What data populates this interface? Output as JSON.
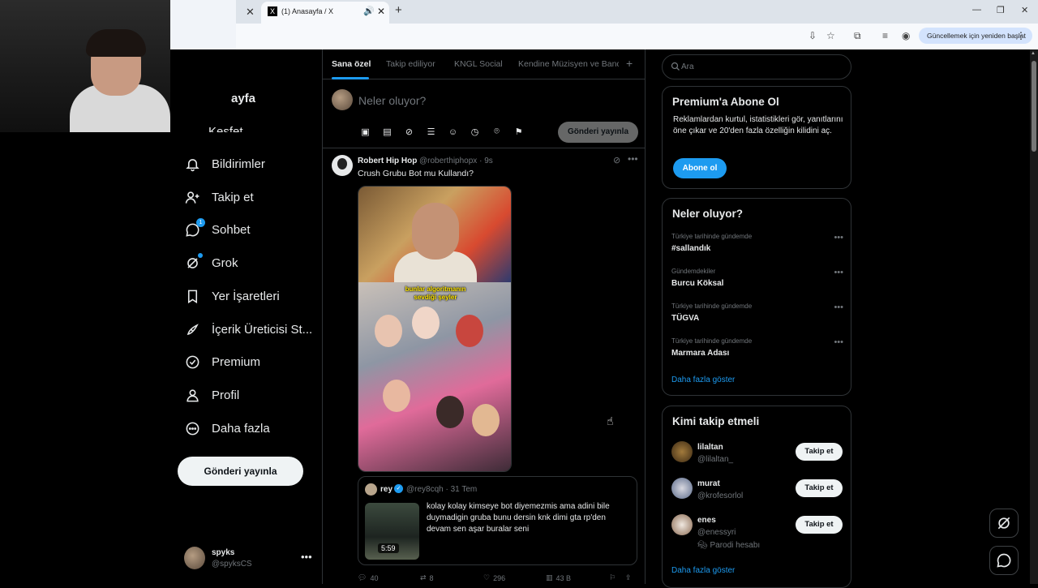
{
  "browser": {
    "tab_title": "(1) Anasayfa / X",
    "favicon": "X",
    "update_label": "Güncellemek için yeniden başlat"
  },
  "nav": {
    "partial_home": "ayfa",
    "partial_explore": "Keşfet",
    "items": [
      {
        "label": "Bildirimler",
        "icon": "bell-icon"
      },
      {
        "label": "Takip et",
        "icon": "add-user-icon"
      },
      {
        "label": "Sohbet",
        "icon": "chat-icon",
        "badge": "1"
      },
      {
        "label": "Grok",
        "icon": "grok-icon"
      },
      {
        "label": "Yer İşaretleri",
        "icon": "bookmark-icon"
      },
      {
        "label": "İçerik Üreticisi St...",
        "icon": "rocket-icon"
      },
      {
        "label": "Premium",
        "icon": "verified-icon"
      },
      {
        "label": "Profil",
        "icon": "person-icon"
      },
      {
        "label": "Daha fazla",
        "icon": "more-circle-icon"
      }
    ],
    "post_button": "Gönderi yayınla"
  },
  "account": {
    "name": "spyks",
    "handle": "@spyksCS"
  },
  "timeline": {
    "tabs": [
      "Sana özel",
      "Takip ediliyor",
      "KNGL Social",
      "Kendine Müzisyen ve Banc"
    ],
    "composer_placeholder": "Neler oluyor?",
    "composer_post": "Gönderi yayınla"
  },
  "tweet": {
    "name": "Robert Hip Hop",
    "handle": "@roberthiphopx · 9s",
    "text": "Crush Grubu Bot mu Kullandı?",
    "media_caption_1": "bunlar algoritmanın",
    "media_caption_2": "sevdiği şeyler",
    "quote": {
      "name": "rey",
      "handle": "@rey8cqh · 31 Tem",
      "text": "kolay kolay kimseye bot diyemezmis ama adini bile duymadigin gruba bunu dersin knk dimi gta rp'den devam sen aşar buralar seni",
      "duration": "5:59"
    },
    "stats": {
      "replies": "40",
      "reposts": "8",
      "likes": "296",
      "views": "43 B"
    }
  },
  "right": {
    "search_placeholder": "Ara",
    "premium": {
      "title": "Premium'a Abone Ol",
      "text": "Reklamlardan kurtul, istatistikleri gör, yanıtlarını öne çıkar ve 20'den fazla özelliğin kilidini aç.",
      "button": "Abone ol"
    },
    "trends": {
      "title": "Neler oluyor?",
      "items": [
        {
          "context": "Türkiye tarihinde gündemde",
          "name": "#sallandık"
        },
        {
          "context": "Gündemdekiler",
          "name": "Burcu Köksal"
        },
        {
          "context": "Türkiye tarihinde gündemde",
          "name": "TÜGVA"
        },
        {
          "context": "Türkiye tarihinde gündemde",
          "name": "Marmara Adası"
        }
      ],
      "show_more": "Daha fazla göster"
    },
    "who_to_follow": {
      "title": "Kimi takip etmeli",
      "items": [
        {
          "name": "lilaltan",
          "handle": "@lilaltan_",
          "button": "Takip et"
        },
        {
          "name": "murat",
          "handle": "@krofesorlol",
          "button": "Takip et"
        },
        {
          "name": "enes",
          "handle": "@enessyri",
          "sub": "Parodi hesabı",
          "button": "Takip et"
        }
      ],
      "show_more": "Daha fazla göster"
    }
  },
  "colors": {
    "accent": "#1d9bf0",
    "background": "#000000",
    "border": "#2f3336",
    "muted": "#71767b"
  }
}
